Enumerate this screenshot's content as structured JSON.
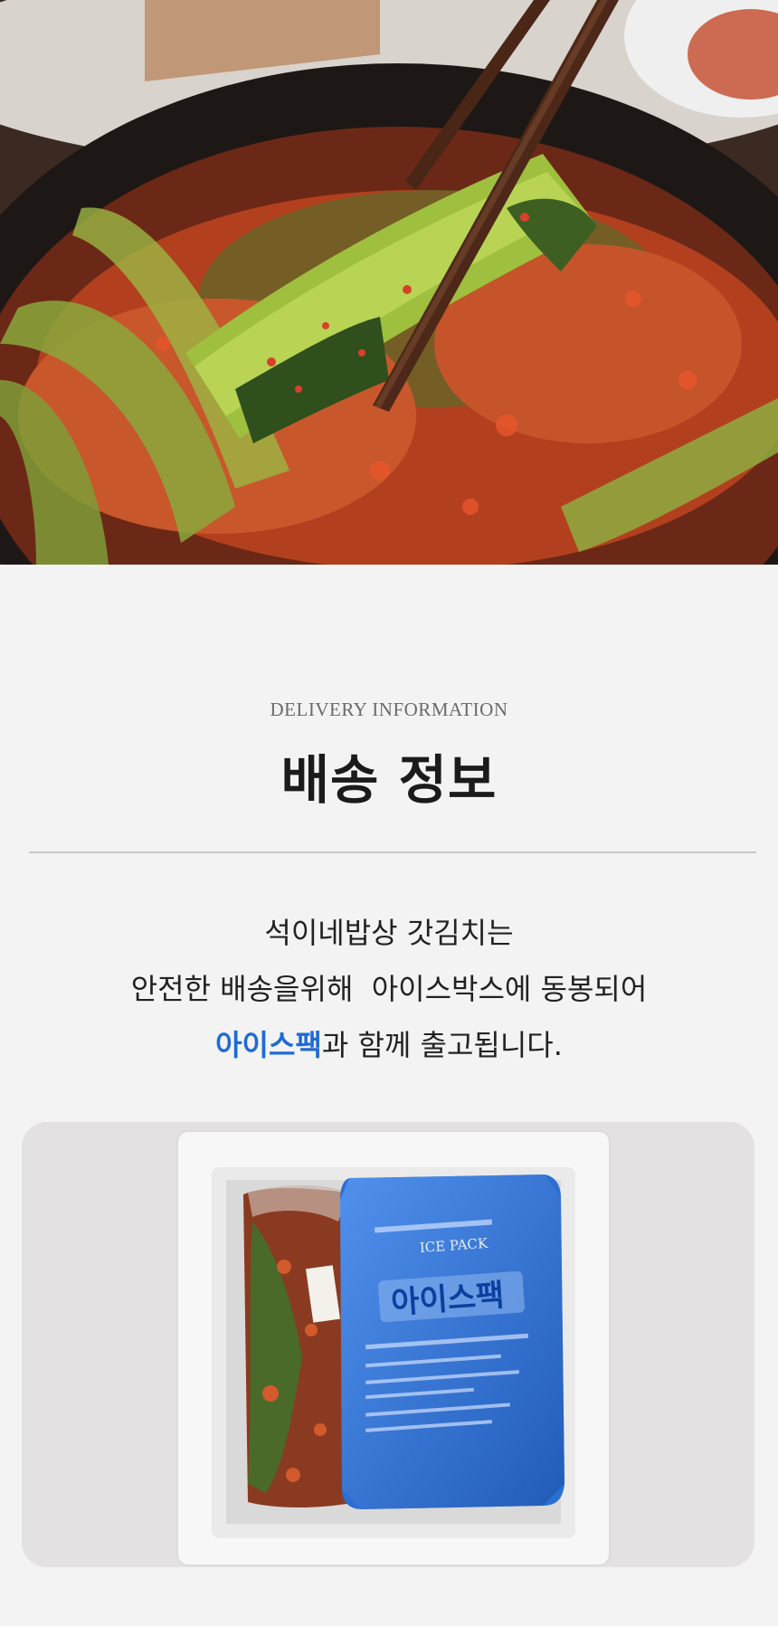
{
  "hero": {
    "image": "kimchi-chopsticks-photo"
  },
  "section": {
    "eyebrow": "DELIVERY INFORMATION",
    "title": "배송 정보"
  },
  "description": {
    "line1": "석이네밥상 갓김치는",
    "line2": "안전한 배송을위해  아이스박스에 동봉되어",
    "line3_highlight": "아이스팩",
    "line3_rest": "과 함께 출고됩니다."
  },
  "box_photo": {
    "image": "icebox-with-kimchi-and-icepack-photo",
    "icepack_title": "아이스팩",
    "icepack_brand": "ICE PACK"
  },
  "colors": {
    "background": "#f3f3f3",
    "highlight": "#1f6ad8",
    "title": "#1b1b1b",
    "eyebrow": "#6a6a6a"
  }
}
